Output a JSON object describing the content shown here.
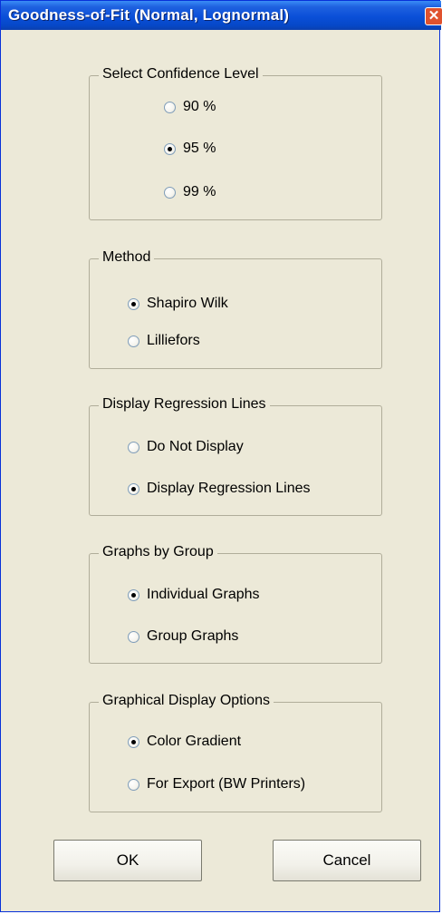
{
  "window": {
    "title": "Goodness-of-Fit (Normal, Lognormal)",
    "close_label": "✕"
  },
  "groups": {
    "confidence": {
      "legend": "Select Confidence Level",
      "options": [
        "90 %",
        "95 %",
        "99 %"
      ],
      "selected": "95 %"
    },
    "method": {
      "legend": "Method",
      "options": [
        "Shapiro Wilk",
        "Lilliefors"
      ],
      "selected": "Shapiro Wilk"
    },
    "regression": {
      "legend": "Display Regression Lines",
      "options": [
        "Do Not Display",
        "Display Regression Lines"
      ],
      "selected": "Display Regression Lines"
    },
    "graphs": {
      "legend": "Graphs by Group",
      "options": [
        "Individual Graphs",
        "Group Graphs"
      ],
      "selected": "Individual Graphs"
    },
    "display": {
      "legend": "Graphical Display Options",
      "options": [
        "Color Gradient",
        "For Export (BW Printers)"
      ],
      "selected": "Color Gradient"
    }
  },
  "buttons": {
    "ok_label": "OK",
    "cancel_label": "Cancel"
  }
}
